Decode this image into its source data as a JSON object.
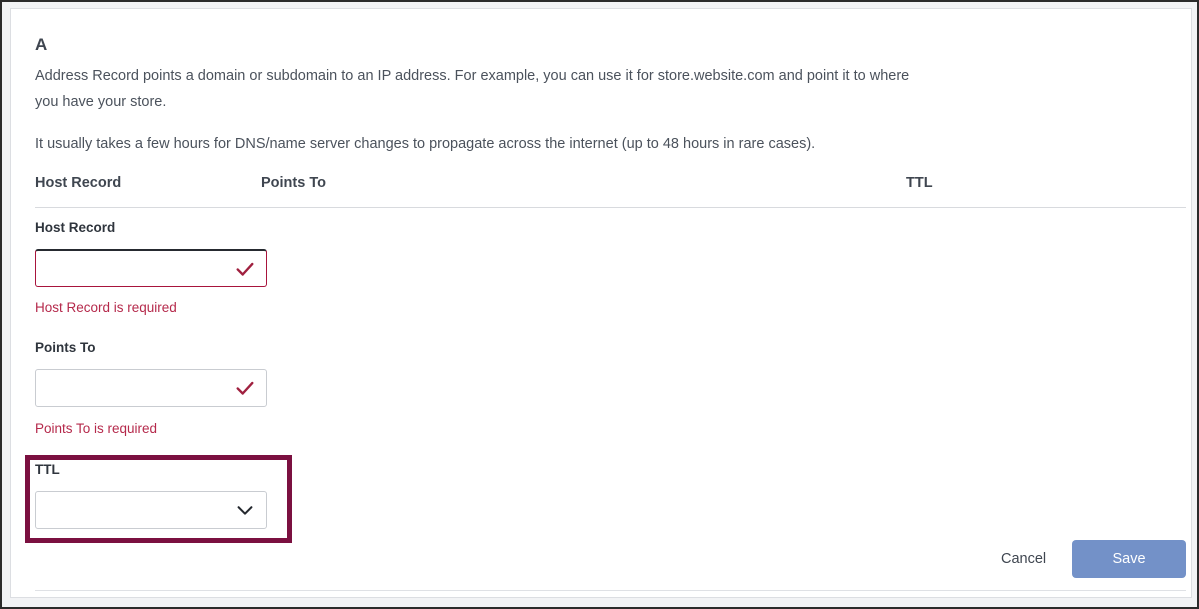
{
  "card": {
    "record_type": "A",
    "description": "Address Record points a domain or subdomain to an IP address. For example, you can use it for store.website.com and point it to where you have your store.",
    "propagation_note": "It usually takes a few hours for DNS/name server changes to propagate across the internet (up to 48 hours in rare cases)."
  },
  "columns": {
    "host_record": "Host Record",
    "points_to": "Points To",
    "ttl": "TTL"
  },
  "fields": {
    "host_record": {
      "label": "Host Record",
      "value": "",
      "placeholder": "",
      "error": "Host Record is required",
      "icon": "check-icon",
      "state": "invalid-focused"
    },
    "points_to": {
      "label": "Points To",
      "value": "",
      "placeholder": "",
      "error": "Points To is required",
      "icon": "check-icon",
      "state": "invalid"
    },
    "ttl": {
      "label": "TTL",
      "value": "",
      "placeholder": "",
      "icon": "chevron-down-icon",
      "state": "highlighted"
    }
  },
  "actions": {
    "cancel_label": "Cancel",
    "save_label": "Save"
  },
  "colors": {
    "highlight_border": "#7b1040",
    "error_text": "#b5294b",
    "check_icon": "#a0203f",
    "invalid_field_border": "#a8143c",
    "focused_top_border": "#262a30",
    "save_button_bg": "#7391c8",
    "heading_text": "#3f4650",
    "body_text": "#4b525c",
    "field_border": "#c9ccd1",
    "rule": "#d8dade",
    "frame_border": "#2b2b2b"
  }
}
